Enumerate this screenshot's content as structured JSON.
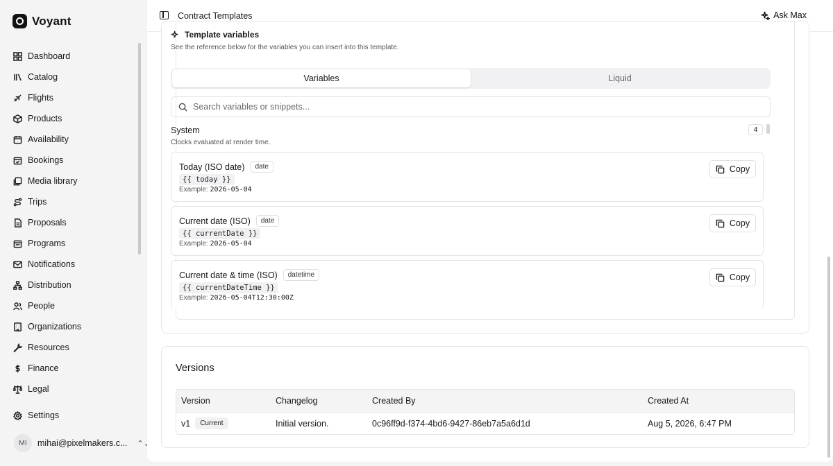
{
  "brand": {
    "name": "Voyant"
  },
  "sidebar": {
    "items": [
      {
        "label": "Dashboard",
        "icon": "dashboard-icon"
      },
      {
        "label": "Catalog",
        "icon": "catalog-icon"
      },
      {
        "label": "Flights",
        "icon": "plane-icon"
      },
      {
        "label": "Products",
        "icon": "package-icon"
      },
      {
        "label": "Availability",
        "icon": "calendar-icon"
      },
      {
        "label": "Bookings",
        "icon": "calendar-check-icon"
      },
      {
        "label": "Media library",
        "icon": "images-icon"
      },
      {
        "label": "Trips",
        "icon": "route-icon"
      },
      {
        "label": "Proposals",
        "icon": "file-text-icon"
      },
      {
        "label": "Programs",
        "icon": "calendar-range-icon"
      },
      {
        "label": "Notifications",
        "icon": "mail-icon"
      },
      {
        "label": "Distribution",
        "icon": "network-icon"
      },
      {
        "label": "People",
        "icon": "users-icon"
      },
      {
        "label": "Organizations",
        "icon": "building-icon"
      },
      {
        "label": "Resources",
        "icon": "wrench-icon"
      },
      {
        "label": "Finance",
        "icon": "dollar-icon"
      },
      {
        "label": "Legal",
        "icon": "scale-icon"
      }
    ],
    "settings": {
      "label": "Settings",
      "icon": "gear-icon"
    },
    "user": {
      "initials": "MI",
      "email": "mihai@pixelmakers.c..."
    }
  },
  "topbar": {
    "title": "Contract Templates",
    "ask_label": "Ask Max"
  },
  "template_vars": {
    "title": "Template variables",
    "subtitle": "See the reference below for the variables you can insert into this template.",
    "tabs": [
      {
        "label": "Variables",
        "active": true
      },
      {
        "label": "Liquid",
        "active": false
      }
    ],
    "search_placeholder": "Search variables or snippets...",
    "section": {
      "title": "System",
      "count": "4",
      "subtitle": "Clocks evaluated at render time."
    },
    "example_label": "Example:",
    "copy_label": "Copy",
    "variables": [
      {
        "name": "Today (ISO date)",
        "type": "date",
        "code": "{{ today }}",
        "example": "2026-05-04"
      },
      {
        "name": "Current date (ISO)",
        "type": "date",
        "code": "{{ currentDate }}",
        "example": "2026-05-04"
      },
      {
        "name": "Current date & time (ISO)",
        "type": "datetime",
        "code": "{{ currentDateTime }}",
        "example": "2026-05-04T12:30:00Z"
      }
    ]
  },
  "versions": {
    "title": "Versions",
    "columns": [
      "Version",
      "Changelog",
      "Created By",
      "Created At"
    ],
    "rows": [
      {
        "version": "v1",
        "badge": "Current",
        "changelog": "Initial version.",
        "created_by": "0c96ff9d-f374-4bd6-9427-86eb7a5a6d1d",
        "created_at": "Aug 5, 2026, 6:47 PM"
      }
    ]
  }
}
